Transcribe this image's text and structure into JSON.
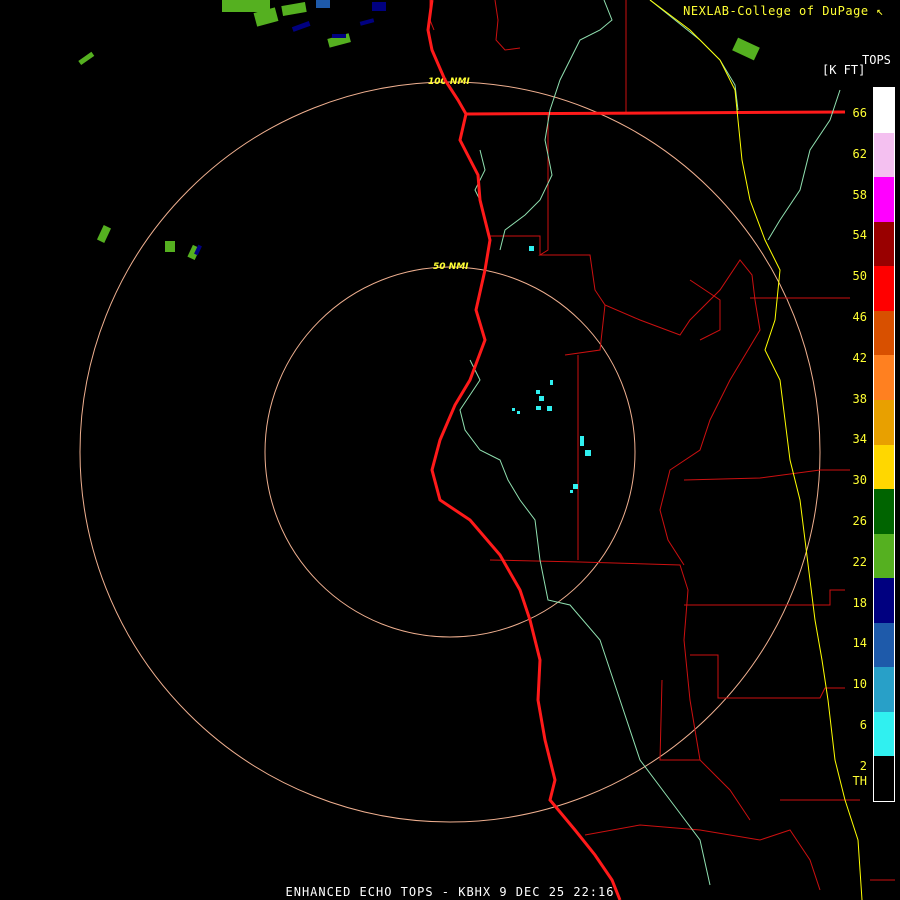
{
  "credit": "NEXLAB-College of DuPage ↖",
  "footer": "ENHANCED ECHO TOPS - KBHX 9 DEC 25 22:16",
  "legend": {
    "title_line1": "TOPS",
    "title_line2": "[K FT]",
    "ticks": [
      "66",
      "62",
      "58",
      "54",
      "50",
      "46",
      "42",
      "38",
      "34",
      "30",
      "26",
      "22",
      "18",
      "14",
      "10",
      "6",
      "2",
      "TH"
    ],
    "colors": [
      "#ffffff",
      "#f4c0f0",
      "#ff00ff",
      "#990000",
      "#ff0000",
      "#d85000",
      "#ff8020",
      "#e8a000",
      "#ffd700",
      "#006400",
      "#55b020",
      "#000080",
      "#1e5aaa",
      "#28a0c8",
      "#30f0f0",
      "#000000"
    ]
  },
  "range_rings": [
    {
      "label": "100 NMI",
      "radius_nmi": 100
    },
    {
      "label": "50 NMI",
      "radius_nmi": 50
    }
  ],
  "colors": {
    "coastline": "#ff1a1a",
    "state_border": "#ff1a1a",
    "county": "#cc1010",
    "river": "#90e0b0",
    "road": "#ffff00",
    "ring": "#f0b090"
  }
}
